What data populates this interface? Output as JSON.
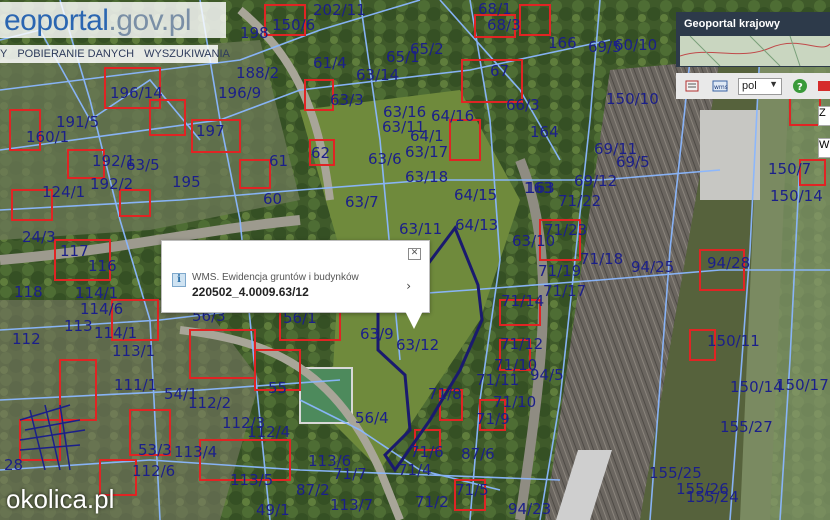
{
  "header": {
    "logo_text": "eoportal",
    "logo_domain": ".gov.pl"
  },
  "menu": {
    "items": [
      "Y",
      "POBIERANIE DANYCH",
      "WYSZUKIWANIA"
    ]
  },
  "panel": {
    "title": "Geoportal krajowy",
    "lang": "pol",
    "btn_a": "Z",
    "btn_b": "W"
  },
  "popup": {
    "layer": "WMS. Ewidencja gruntów i budynków",
    "parcel_id": "220502_4.0009.63/12"
  },
  "watermark": "okolica.pl",
  "colors": {
    "parcel_line": "#1b1f8a",
    "boundary": "#8ab7ff",
    "building": "#e02424",
    "selection": "#1a1a6e"
  },
  "parcel_labels": [
    "150/6",
    "202/11",
    "68/1",
    "68/3",
    "166",
    "69/5",
    "60/10",
    "150/10",
    "198",
    "61/4",
    "65/2",
    "65/1",
    "67",
    "63/14",
    "196/14",
    "196/9",
    "188/2",
    "63/3",
    "66/3",
    "63/16",
    "63/11",
    "64/16",
    "164",
    "191/5",
    "160/1",
    "197",
    "62",
    "64/1",
    "63/6",
    "63/17",
    "69/11",
    "163",
    "69/5",
    "192/1",
    "192/2",
    "63/5",
    "61",
    "60",
    "63/7",
    "63/18",
    "64/15",
    "163",
    "69/12",
    "195",
    "71/22",
    "64/13",
    "124/1",
    "63/11",
    "24/3",
    "63/10",
    "117",
    "71/23",
    "116",
    "71/18",
    "94/25",
    "94/28",
    "118",
    "71/19",
    "71/17",
    "114/1",
    "114/6",
    "56/3",
    "56/1",
    "63/9",
    "71/14",
    "63/12",
    "71/12",
    "113",
    "114/1",
    "71/10",
    "71/11",
    "94/5",
    "150/11",
    "112",
    "113/1",
    "111/1",
    "55",
    "54/1",
    "112/2",
    "71/8",
    "150/14",
    "150/17",
    "112/3",
    "112/4",
    "56/4",
    "71/9",
    "71/10",
    "155/27",
    "53/3",
    "113/4",
    "113/6",
    "71/7",
    "71/6",
    "87/6",
    "112/6",
    "113/5",
    "87/2",
    "71/4",
    "71/5",
    "155/25",
    "155/26",
    "49/1",
    "113/7",
    "71/2",
    "94/23",
    "155/24",
    "28",
    "150/7",
    "150/14"
  ]
}
